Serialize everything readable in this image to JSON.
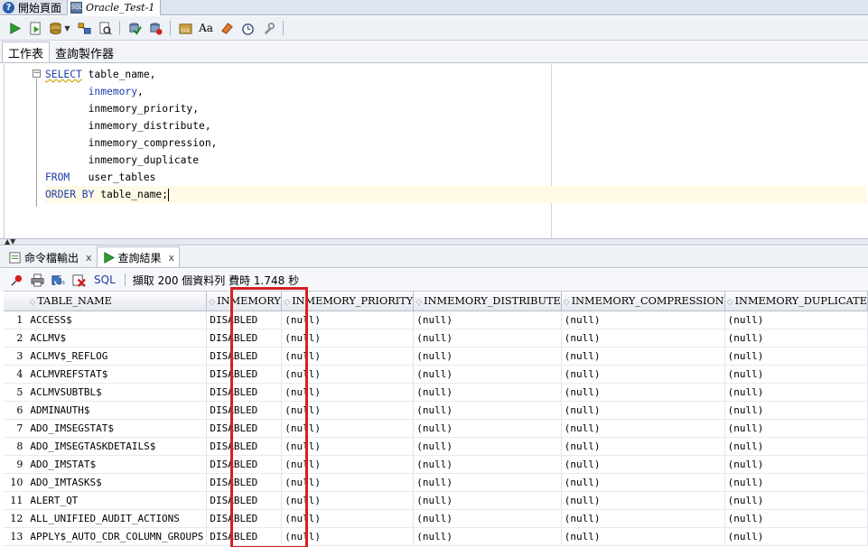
{
  "doc_tabs": [
    {
      "label": "開始頁面",
      "icon": "help-icon"
    },
    {
      "label": "Oracle_Test-1",
      "icon": "sql-worksheet-icon"
    }
  ],
  "worksheet_tabs": [
    {
      "label": "工作表"
    },
    {
      "label": "查詢製作器"
    }
  ],
  "editor": {
    "lines": [
      "SELECT table_name,",
      "       inmemory,",
      "       inmemory_priority,",
      "       inmemory_distribute,",
      "       inmemory_compression,",
      "       inmemory_duplicate",
      "FROM   user_tables",
      "ORDER BY table_name;"
    ]
  },
  "result_tabs": [
    {
      "label": "命令檔輸出",
      "close": "x"
    },
    {
      "label": "查詢結果",
      "close": "x"
    }
  ],
  "result_toolbar": {
    "sql_label": "SQL",
    "status": "擷取 200 個資料列 費時 1.748 秒"
  },
  "grid": {
    "columns": [
      "TABLE_NAME",
      "INMEMORY",
      "INMEMORY_PRIORITY",
      "INMEMORY_DISTRIBUTE",
      "INMEMORY_COMPRESSION",
      "INMEMORY_DUPLICATE"
    ],
    "rows": [
      {
        "n": "1",
        "cells": [
          "ACCESS$",
          "DISABLED",
          "(null)",
          "(null)",
          "(null)",
          "(null)"
        ]
      },
      {
        "n": "2",
        "cells": [
          "ACLMV$",
          "DISABLED",
          "(null)",
          "(null)",
          "(null)",
          "(null)"
        ]
      },
      {
        "n": "3",
        "cells": [
          "ACLMV$_REFLOG",
          "DISABLED",
          "(null)",
          "(null)",
          "(null)",
          "(null)"
        ]
      },
      {
        "n": "4",
        "cells": [
          "ACLMVREFSTAT$",
          "DISABLED",
          "(null)",
          "(null)",
          "(null)",
          "(null)"
        ]
      },
      {
        "n": "5",
        "cells": [
          "ACLMVSUBTBL$",
          "DISABLED",
          "(null)",
          "(null)",
          "(null)",
          "(null)"
        ]
      },
      {
        "n": "6",
        "cells": [
          "ADMINAUTH$",
          "DISABLED",
          "(null)",
          "(null)",
          "(null)",
          "(null)"
        ]
      },
      {
        "n": "7",
        "cells": [
          "ADO_IMSEGSTAT$",
          "DISABLED",
          "(null)",
          "(null)",
          "(null)",
          "(null)"
        ]
      },
      {
        "n": "8",
        "cells": [
          "ADO_IMSEGTASKDETAILS$",
          "DISABLED",
          "(null)",
          "(null)",
          "(null)",
          "(null)"
        ]
      },
      {
        "n": "9",
        "cells": [
          "ADO_IMSTAT$",
          "DISABLED",
          "(null)",
          "(null)",
          "(null)",
          "(null)"
        ]
      },
      {
        "n": "10",
        "cells": [
          "ADO_IMTASKS$",
          "DISABLED",
          "(null)",
          "(null)",
          "(null)",
          "(null)"
        ]
      },
      {
        "n": "11",
        "cells": [
          "ALERT_QT",
          "DISABLED",
          "(null)",
          "(null)",
          "(null)",
          "(null)"
        ]
      },
      {
        "n": "12",
        "cells": [
          "ALL_UNIFIED_AUDIT_ACTIONS",
          "DISABLED",
          "(null)",
          "(null)",
          "(null)",
          "(null)"
        ]
      },
      {
        "n": "13",
        "cells": [
          "APPLY$_AUTO_CDR_COLUMN_GROUPS",
          "DISABLED",
          "(null)",
          "(null)",
          "(null)",
          "(null)"
        ]
      }
    ]
  },
  "colors": {
    "keyword": "#1f3ea8",
    "highlight": "#d62020"
  }
}
